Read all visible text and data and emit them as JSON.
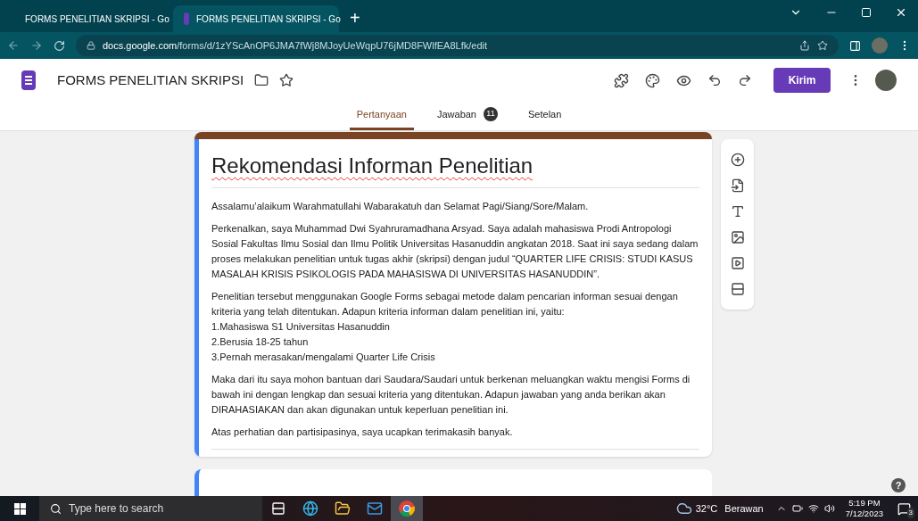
{
  "browser": {
    "tabs": [
      {
        "title": "FORMS PENELITIAN SKRIPSI - Go",
        "kind": "drive",
        "selected": false
      },
      {
        "title": "FORMS PENELITIAN SKRIPSI - Go",
        "kind": "forms",
        "selected": true
      }
    ],
    "new_tab": "+",
    "url_host": "docs.google.com",
    "url_path": "/forms/d/1zYScAnOP6JMA7fWj8MJoyUeWqpU76jMD8FWlfEA8Lfk/edit"
  },
  "header": {
    "title": "FORMS PENELITIAN SKRIPSI",
    "send_button": "Kirim"
  },
  "tabs": [
    {
      "label": "Pertanyaan",
      "selected": true
    },
    {
      "label": "Jawaban",
      "badge": "11",
      "selected": false
    },
    {
      "label": "Setelan",
      "selected": false
    }
  ],
  "form": {
    "title": "Rekomendasi Informan Penelitian",
    "paragraphs": [
      [
        "Assalamu’alaikum Warahmatullahi Wabarakatuh dan Selamat Pagi/Siang/Sore/Malam."
      ],
      [
        "Perkenalkan, saya Muhammad Dwi Syahruramadhana Arsyad. Saya adalah mahasiswa Prodi Antropologi Sosial Fakultas Ilmu Sosial dan Ilmu Politik Universitas Hasanuddin angkatan 2018. Saat ini saya sedang dalam proses melakukan penelitian untuk tugas akhir (skripsi) dengan judul “QUARTER LIFE CRISIS: STUDI KASUS MASALAH KRISIS PSIKOLOGIS PADA MAHASISWA DI UNIVERSITAS HASANUDDIN”."
      ],
      [
        "Penelitian tersebut menggunakan Google Forms sebagai metode dalam pencarian informan sesuai dengan kriteria yang telah ditentukan. Adapun kriteria informan dalam penelitian ini, yaitu:",
        "1.Mahasiswa S1 Universitas Hasanuddin",
        "2.Berusia 18-25 tahun",
        "3.Pernah merasakan/mengalami Quarter Life Crisis"
      ],
      [
        "Maka dari itu saya mohon bantuan dari Saudara/Saudari untuk berkenan meluangkan waktu mengisi Forms di bawah ini dengan lengkap dan sesuai kriteria yang ditentukan. Adapun jawaban yang anda berikan akan DIRAHASIAKAN dan akan digunakan untuk keperluan penelitian ini."
      ],
      [
        "Atas perhatian dan partisipasinya, saya ucapkan terimakasih banyak."
      ]
    ]
  },
  "help": "?",
  "taskbar": {
    "search_placeholder": "Type here to search",
    "apps": [
      {
        "kind": "taskview",
        "selected": false
      },
      {
        "kind": "edge",
        "selected": false
      },
      {
        "kind": "explorer",
        "selected": false
      },
      {
        "kind": "mail",
        "selected": false
      },
      {
        "kind": "chrome",
        "selected": true
      }
    ],
    "temperature": "32°C",
    "weather": "Berawan",
    "time": "5:19 PM",
    "date": "7/12/2023",
    "notifications": "3"
  }
}
